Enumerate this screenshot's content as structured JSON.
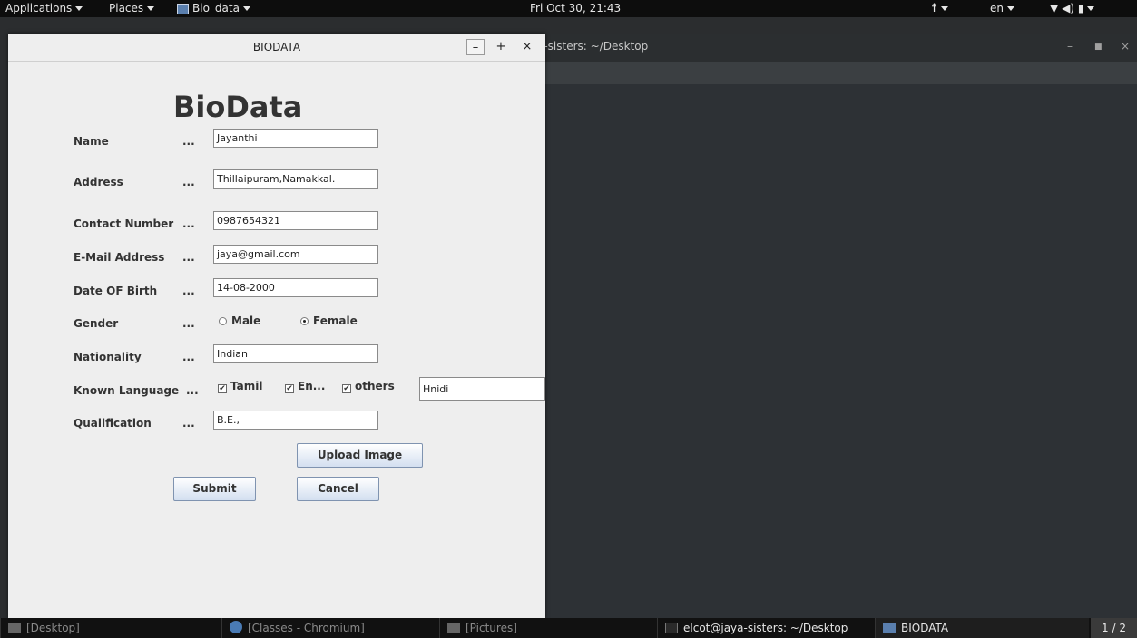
{
  "topbar": {
    "applications": "Applications",
    "places": "Places",
    "active_app": "Bio_data",
    "clock": "Fri Oct 30, 21:43",
    "language": "en"
  },
  "terminal": {
    "title": "a-sisters: ~/Desktop"
  },
  "window": {
    "title": "BIODATA",
    "heading": "BioData",
    "controls": {
      "minimize": "–",
      "maximize": "+",
      "close": "×"
    },
    "dots": "...",
    "labels": {
      "name": "Name",
      "address": "Address",
      "contact": "Contact Number",
      "email": "E-Mail Address",
      "dob": "Date OF Birth",
      "gender": "Gender",
      "nationality": "Nationality",
      "languages": "Known Language",
      "qualification": "Qualification"
    },
    "values": {
      "name": "Jayanthi",
      "address": "Thillaipuram,Namakkal.",
      "contact": "0987654321",
      "email": "jaya@gmail.com",
      "dob": "14-08-2000",
      "nationality": "Indian",
      "other_language": "Hnidi",
      "qualification": "B.E.,"
    },
    "gender": {
      "male": "Male",
      "female": "Female",
      "selected": "Female"
    },
    "language_options": {
      "tamil": "Tamil",
      "english": "En...",
      "others": "others"
    },
    "buttons": {
      "upload": "Upload Image",
      "submit": "Submit",
      "cancel": "Cancel"
    }
  },
  "taskbar": {
    "items": [
      "[Desktop]",
      "[Classes - Chromium]",
      "[Pictures]",
      "elcot@jaya-sisters: ~/Desktop",
      "BIODATA"
    ],
    "pager": "1 / 2"
  }
}
